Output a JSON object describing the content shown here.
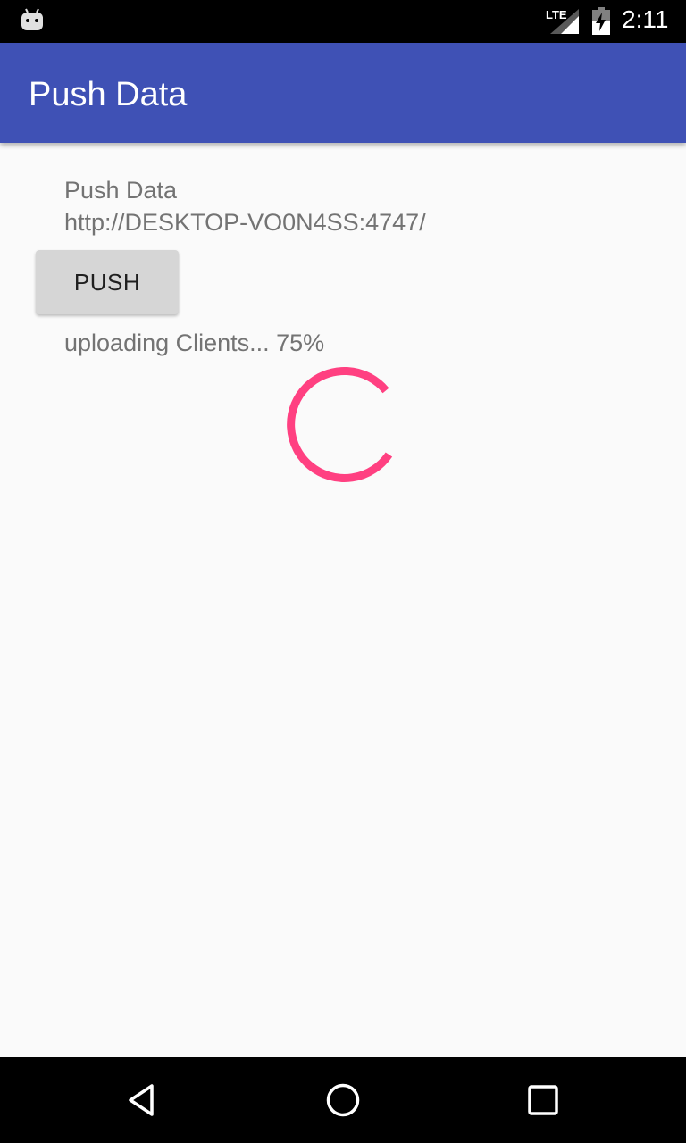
{
  "status_bar": {
    "notification_icon": "android-icon",
    "network_label": "LTE",
    "signal_icon": "signal-icon",
    "battery_icon": "battery-charging-icon",
    "time": "2:11"
  },
  "app_bar": {
    "title": "Push Data",
    "color": "#3f51b5"
  },
  "content": {
    "heading": "Push Data",
    "server_url": "http://DESKTOP-VO0N4SS:4747/",
    "push_button_label": "PUSH",
    "upload_status": "uploading Clients...  75%",
    "progress_percent": 75,
    "spinner_color": "#ff4081"
  },
  "nav_bar": {
    "back_icon": "back-icon",
    "home_icon": "home-icon",
    "recents_icon": "recents-icon"
  }
}
